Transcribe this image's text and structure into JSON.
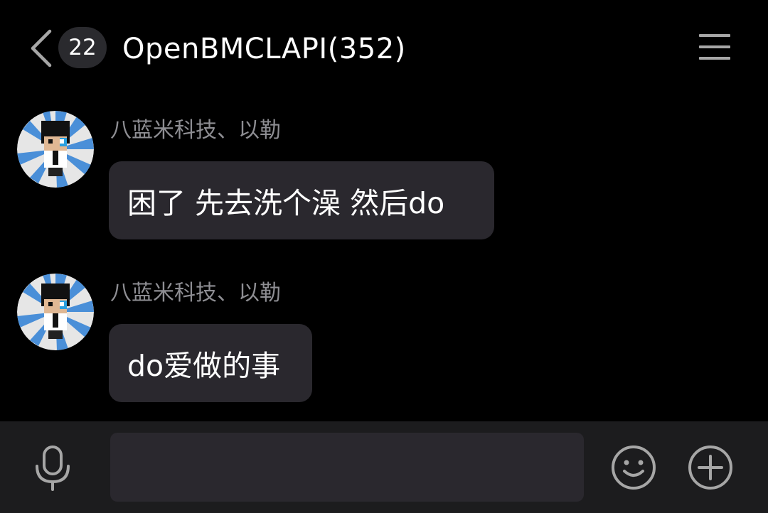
{
  "header": {
    "back_icon": "chevron-left-icon",
    "unread_count": "22",
    "title": "OpenBMCLAPI(352)",
    "menu_icon": "hamburger-menu-icon"
  },
  "messages": [
    {
      "sender": "八蓝米科技、以勒",
      "text": "困了 先去洗个澡 然后do"
    },
    {
      "sender": "八蓝米科技、以勒",
      "text": "do爱做的事"
    }
  ],
  "input_bar": {
    "mic_icon": "microphone-icon",
    "input_value": "",
    "input_placeholder": "",
    "emoji_icon": "smiley-icon",
    "plus_icon": "plus-circle-icon"
  },
  "colors": {
    "background": "#000000",
    "bubble": "#2a282e",
    "badge": "#2a2a2e",
    "sender_text": "#8e8e93",
    "input_bar": "#1c1c1e",
    "icon_gray": "#a6a6a6",
    "avatar_ring": "#4a8fd8"
  }
}
